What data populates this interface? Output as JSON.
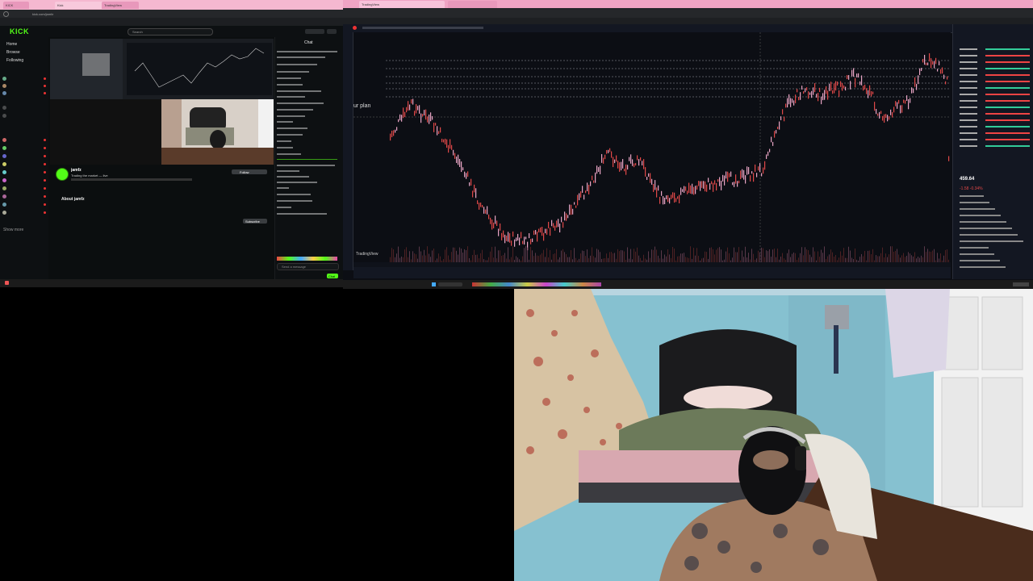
{
  "left_browser": {
    "tabs": [
      "KICK",
      "Kick",
      "TradingView"
    ],
    "url": "kick.com/jamfz",
    "site": {
      "logo": "KICK",
      "search_placeholder": "Search"
    },
    "sidebar": {
      "sections": [
        "Home",
        "Browse",
        "Following"
      ],
      "followed_count": 12,
      "recommended_count": 9,
      "show_more": "Show more"
    },
    "stream": {
      "streamer": "jamfz",
      "title": "Trading the market — live",
      "follow_label": "Follow",
      "subscribe_label": "Subscribe",
      "about_label": "About jamfz"
    },
    "chat": {
      "header": "Chat",
      "input_placeholder": "Send a message",
      "send_label": "Chat"
    }
  },
  "right_browser": {
    "tabs": [
      "TradingView"
    ],
    "app": "TradingView",
    "chart": {
      "overlay_label": "ur plan",
      "watermark": "TradingView"
    },
    "quote": {
      "price": "459.64",
      "change": "-1.58 -0.34%"
    }
  },
  "colors": {
    "kick_green": "#53fc18",
    "tab_pink": "#f0a4c4",
    "chart_bg": "#0c0e14",
    "candle_up": "#e8a4c4",
    "candle_down": "#e04848"
  },
  "icons": [
    "search-icon",
    "close-icon",
    "crosshair-icon",
    "windows-start-icon"
  ]
}
